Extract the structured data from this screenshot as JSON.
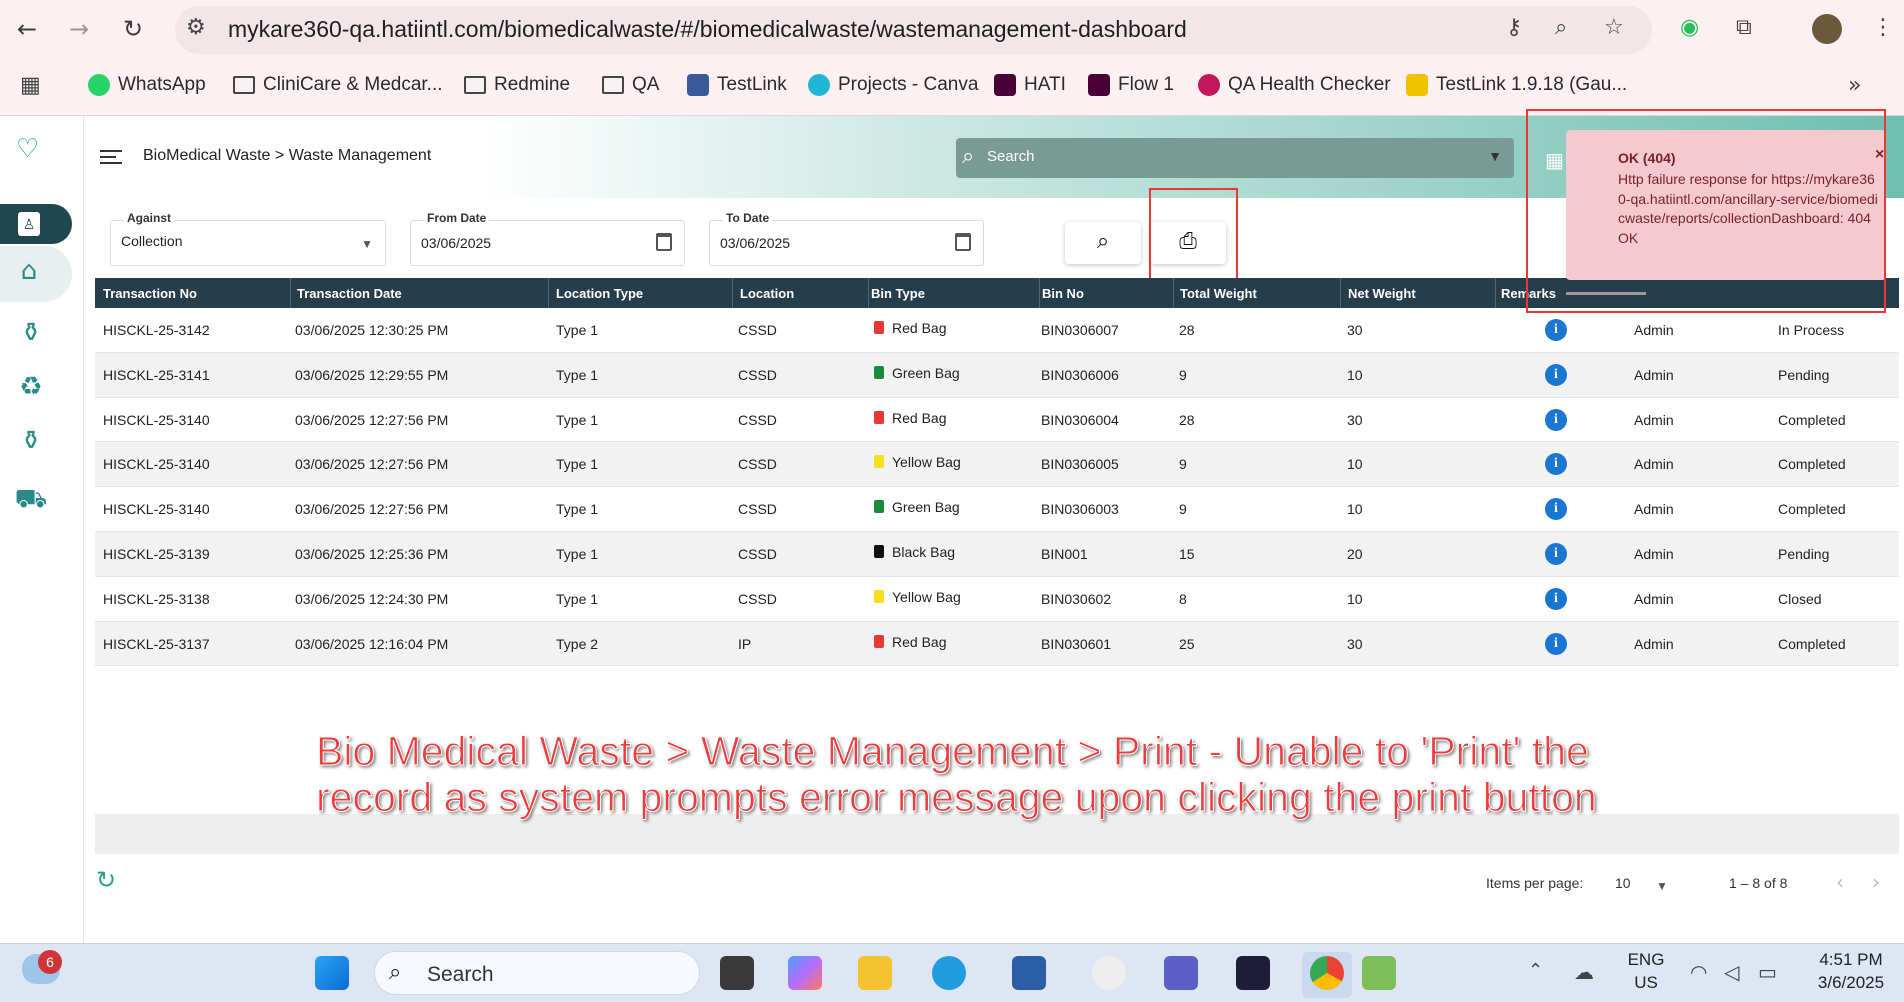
{
  "browser": {
    "url": "mykare360-qa.hatiintl.com/biomedicalwaste/#/biomedicalwaste/wastemanagement-dashboard",
    "bookmarks": [
      "WhatsApp",
      "CliniCare & Medcar...",
      "Redmine",
      "QA",
      "TestLink",
      "Projects - Canva",
      "HATI",
      "Flow 1",
      "QA Health Checker",
      "TestLink 1.9.18 (Gau..."
    ]
  },
  "header": {
    "breadcrumb": "BioMedical Waste > Waste Management",
    "search_placeholder": "Search"
  },
  "filters": {
    "against_label": "Against",
    "against_value": "Collection",
    "from_label": "From Date",
    "from_value": "03/06/2025",
    "to_label": "To Date",
    "to_value": "03/06/2025"
  },
  "table": {
    "columns": [
      "Transaction No",
      "Transaction Date",
      "Location Type",
      "Location",
      "Bin Type",
      "Bin No",
      "Total Weight",
      "Net Weight",
      "Remarks"
    ],
    "rows": [
      {
        "txn": "HISCKL-25-3142",
        "date": "03/06/2025 12:30:25 PM",
        "ltype": "Type 1",
        "loc": "CSSD",
        "bin": "Red Bag",
        "bincolor": "#e53935",
        "binno": "BIN0306007",
        "total": "28",
        "net": "30",
        "user": "Admin",
        "status": "In Process"
      },
      {
        "txn": "HISCKL-25-3141",
        "date": "03/06/2025 12:29:55 PM",
        "ltype": "Type 1",
        "loc": "CSSD",
        "bin": "Green Bag",
        "bincolor": "#1b8a3a",
        "binno": "BIN0306006",
        "total": "9",
        "net": "10",
        "user": "Admin",
        "status": "Pending"
      },
      {
        "txn": "HISCKL-25-3140",
        "date": "03/06/2025 12:27:56 PM",
        "ltype": "Type 1",
        "loc": "CSSD",
        "bin": "Red Bag",
        "bincolor": "#e53935",
        "binno": "BIN0306004",
        "total": "28",
        "net": "30",
        "user": "Admin",
        "status": "Completed"
      },
      {
        "txn": "HISCKL-25-3140",
        "date": "03/06/2025 12:27:56 PM",
        "ltype": "Type 1",
        "loc": "CSSD",
        "bin": "Yellow Bag",
        "bincolor": "#f5e020",
        "binno": "BIN0306005",
        "total": "9",
        "net": "10",
        "user": "Admin",
        "status": "Completed"
      },
      {
        "txn": "HISCKL-25-3140",
        "date": "03/06/2025 12:27:56 PM",
        "ltype": "Type 1",
        "loc": "CSSD",
        "bin": "Green Bag",
        "bincolor": "#1b8a3a",
        "binno": "BIN0306003",
        "total": "9",
        "net": "10",
        "user": "Admin",
        "status": "Completed"
      },
      {
        "txn": "HISCKL-25-3139",
        "date": "03/06/2025 12:25:36 PM",
        "ltype": "Type 1",
        "loc": "CSSD",
        "bin": "Black Bag",
        "bincolor": "#111111",
        "binno": "BIN001",
        "total": "15",
        "net": "20",
        "user": "Admin",
        "status": "Pending"
      },
      {
        "txn": "HISCKL-25-3138",
        "date": "03/06/2025 12:24:30 PM",
        "ltype": "Type 1",
        "loc": "CSSD",
        "bin": "Yellow Bag",
        "bincolor": "#f5e020",
        "binno": "BIN030602",
        "total": "8",
        "net": "10",
        "user": "Admin",
        "status": "Closed"
      },
      {
        "txn": "HISCKL-25-3137",
        "date": "03/06/2025 12:16:04 PM",
        "ltype": "Type 2",
        "loc": "IP",
        "bin": "Red Bag",
        "bincolor": "#e53935",
        "binno": "BIN030601",
        "total": "25",
        "net": "30",
        "user": "Admin",
        "status": "Completed"
      }
    ]
  },
  "pager": {
    "items_label": "Items per page:",
    "per_page": "10",
    "range": "1 – 8 of 8"
  },
  "toast": {
    "title": "OK (404)",
    "message": "Http failure response for https://mykare360-qa.hatiintl.com/ancillary-service/biomedicwaste/reports/collectionDashboard: 404 OK",
    "close": "×"
  },
  "annotation": {
    "line1": "Bio Medical Waste > Waste Management > Print - Unable to 'Print' the",
    "line2": "record as system prompts error message upon clicking the print button"
  },
  "taskbar": {
    "search": "Search",
    "badge": "6",
    "lang1": "ENG",
    "lang2": "US",
    "time": "4:51 PM",
    "date": "3/6/2025"
  }
}
